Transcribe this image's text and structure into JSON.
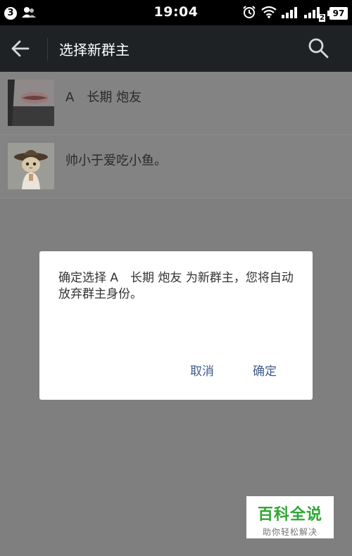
{
  "status_bar": {
    "notification_count": "3",
    "time": "19:04",
    "sim2_label": "2",
    "battery": "97",
    "icons": [
      "contacts-icon",
      "alarm-icon",
      "wifi-icon",
      "signal-icon",
      "signal-icon-2",
      "battery-icon"
    ]
  },
  "header": {
    "title": "选择新群主",
    "back_icon": "back-arrow-icon",
    "search_icon": "search-icon"
  },
  "members": [
    {
      "name": "A　长期 炮友"
    },
    {
      "name": "帅小于爱吃小鱼。"
    }
  ],
  "dialog": {
    "message": "确定选择 A　长期 炮友 为新群主，您将自动放弃群主身份。",
    "cancel_label": "取消",
    "confirm_label": "确定"
  },
  "watermark": {
    "title": "百科全说",
    "subtitle": "助你轻松解决"
  },
  "colors": {
    "status_bar_bg": "#000000",
    "header_bg": "#1f2225",
    "dim_overlay": "#7f7f7f",
    "dialog_button": "#3d5a8a",
    "watermark_green": "#2ea832"
  }
}
